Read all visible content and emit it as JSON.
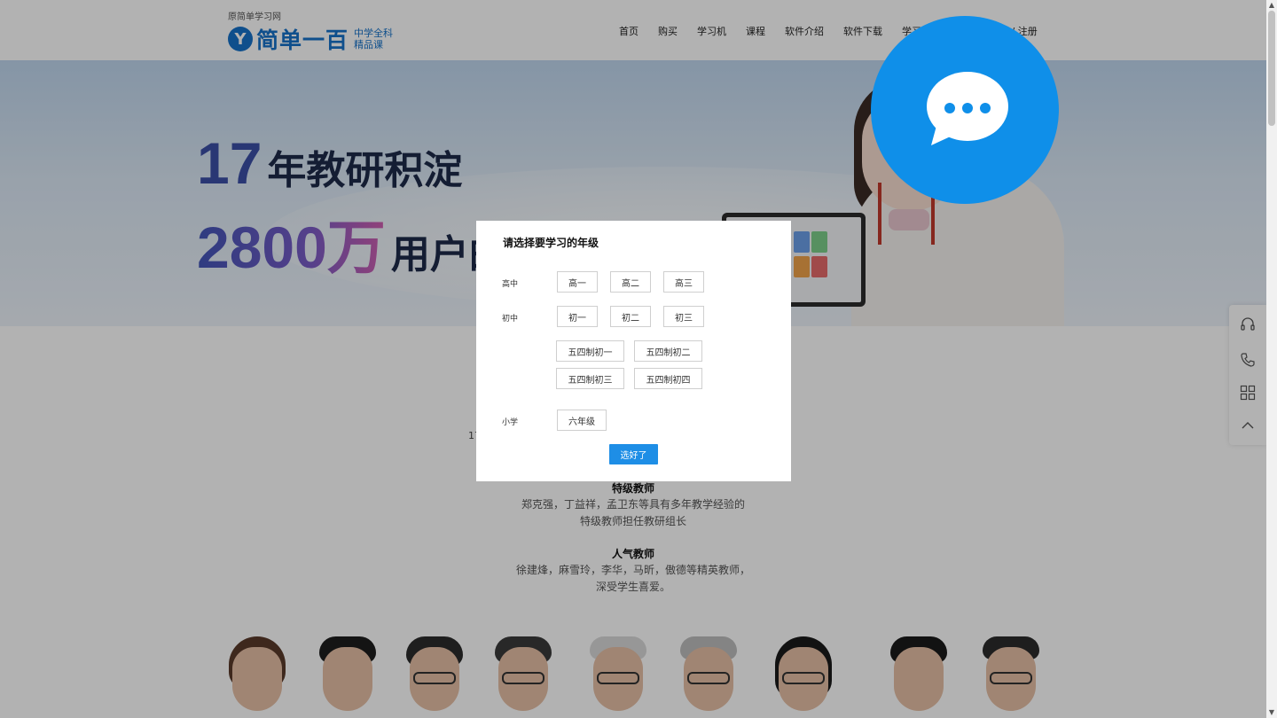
{
  "header": {
    "logo_subtitle": "原简单学习网",
    "logo_letter": "Y",
    "logo_name": "简单一百",
    "logo_tag_line1": "中学全科",
    "logo_tag_line2": "精品课",
    "nav": [
      "首页",
      "购买",
      "学习机",
      "课程",
      "软件介绍",
      "软件下载",
      "学习"
    ],
    "login": "录 / 注册"
  },
  "banner": {
    "line1_number": "17",
    "line1_text": "年教研积淀",
    "line2_number": "2800万",
    "line2_text": "用户的选择"
  },
  "content": {
    "fragment": "17",
    "special_teachers": {
      "title": "特级教师",
      "desc_line1": "郑克强，丁益祥，孟卫东等具有多年教学经验的",
      "desc_line2": "特级教师担任教研组长"
    },
    "popular_teachers": {
      "title": "人气教师",
      "desc_line1": "徐建烽，麻雪玲，李华，马昕，傲德等精英教师，",
      "desc_line2": "深受学生喜爱。"
    }
  },
  "modal": {
    "title": "请选择要学习的年级",
    "high_school": {
      "label": "高中",
      "grades": [
        "高一",
        "高二",
        "高三"
      ]
    },
    "junior_high": {
      "label": "初中",
      "grades": [
        "初一",
        "初二",
        "初三"
      ]
    },
    "five_four": {
      "grades": [
        "五四制初一",
        "五四制初二",
        "五四制初三",
        "五四制初四"
      ]
    },
    "primary": {
      "label": "小学",
      "grades": [
        "六年级"
      ]
    },
    "confirm_label": "选好了"
  },
  "chat": {
    "icon": "chat-bubble-icon",
    "color": "#0f8fe9"
  },
  "sidebar": {
    "icons": [
      "headset-icon",
      "phone-icon",
      "qrcode-icon",
      "back-to-top-icon"
    ]
  },
  "colors": {
    "brand": "#1672c9",
    "accent": "#1e8ee6",
    "chat": "#0f8fe9"
  }
}
